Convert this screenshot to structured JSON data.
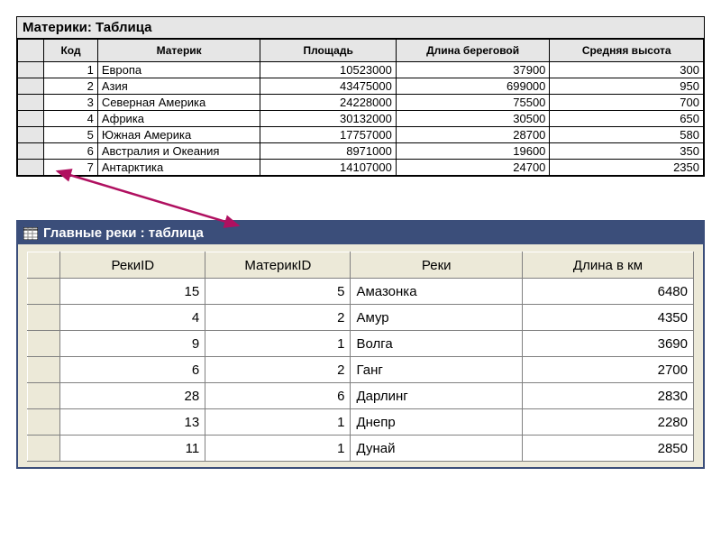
{
  "table1": {
    "title": "Материки: Таблица",
    "headers": {
      "key": "Код",
      "name": "Материк",
      "area": "Площадь",
      "coast": "Длина береговой",
      "alt": "Средняя высота"
    },
    "rows": [
      {
        "key": "1",
        "name": "Европа",
        "area": "10523000",
        "coast": "37900",
        "alt": "300"
      },
      {
        "key": "2",
        "name": "Азия",
        "area": "43475000",
        "coast": "699000",
        "alt": "950"
      },
      {
        "key": "3",
        "name": "Северная Америка",
        "area": "24228000",
        "coast": "75500",
        "alt": "700"
      },
      {
        "key": "4",
        "name": "Африка",
        "area": "30132000",
        "coast": "30500",
        "alt": "650"
      },
      {
        "key": "5",
        "name": "Южная Америка",
        "area": "17757000",
        "coast": "28700",
        "alt": "580"
      },
      {
        "key": "6",
        "name": "Австралия и Океания",
        "area": "8971000",
        "coast": "19600",
        "alt": "350"
      },
      {
        "key": "7",
        "name": "Антарктика",
        "area": "14107000",
        "coast": "24700",
        "alt": "2350"
      }
    ]
  },
  "table2": {
    "title": "Главные реки : таблица",
    "headers": {
      "rid": "РекиID",
      "mid": "МатерикID",
      "name": "Реки",
      "len": "Длина в км"
    },
    "rows": [
      {
        "rid": "15",
        "mid": "5",
        "name": "Амазонка",
        "len": "6480"
      },
      {
        "rid": "4",
        "mid": "2",
        "name": "Амур",
        "len": "4350"
      },
      {
        "rid": "9",
        "mid": "1",
        "name": "Волга",
        "len": "3690"
      },
      {
        "rid": "6",
        "mid": "2",
        "name": "Ганг",
        "len": "2700"
      },
      {
        "rid": "28",
        "mid": "6",
        "name": "Дарлинг",
        "len": "2830"
      },
      {
        "rid": "13",
        "mid": "1",
        "name": "Днепр",
        "len": "2280"
      },
      {
        "rid": "11",
        "mid": "1",
        "name": "Дунай",
        "len": "2850"
      }
    ]
  }
}
